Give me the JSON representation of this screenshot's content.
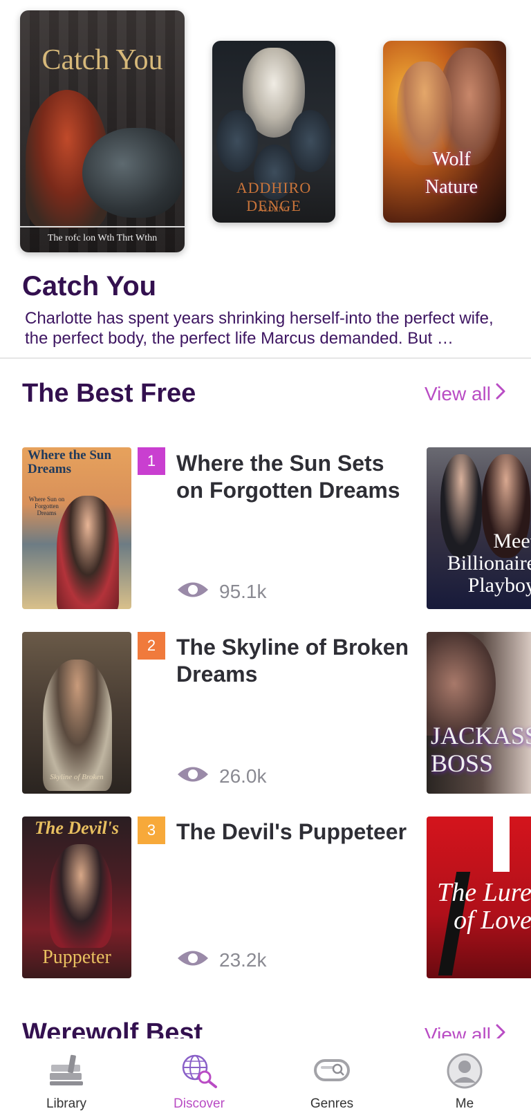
{
  "carousel": {
    "items": [
      {
        "title": "Catch You",
        "subtitle": "The rofc  lon Wth Thrt Wthn"
      },
      {
        "title": "ADDHIRO DENGE",
        "subtitle": "ALDENG"
      },
      {
        "title": "Wolf Nature"
      }
    ]
  },
  "featured": {
    "title": "Catch You",
    "description": "Charlotte has spent years shrinking herself-into the perfect wife, the perfect body, the perfect life Marcus demanded. But …"
  },
  "best_free": {
    "title": "The Best Free",
    "view_all": "View all",
    "books": [
      {
        "rank": "1",
        "rank_color": "#c93fd0",
        "title": "Where the Sun Sets on Forgotten Dreams",
        "views": "95.1k",
        "cover_text": "Where the Sun Dreams",
        "cover_sub": "Where Sun on Forgotten Dreams"
      },
      {
        "rank": "2",
        "rank_color": "#f07a3c",
        "title": "The Skyline of Broken Dreams",
        "views": "26.0k",
        "cover_text": "Skyline of Broken"
      },
      {
        "rank": "3",
        "rank_color": "#f7a93a",
        "title": "The Devil's Puppeteer",
        "views": "23.2k",
        "cover_text": "The Devil's",
        "cover_sub": "Puppeter"
      }
    ],
    "side_covers": [
      {
        "text": "Meet Billionaire Playboy"
      },
      {
        "text": "JACKASS BOSS"
      },
      {
        "text": "The Lure of Love"
      }
    ]
  },
  "werewolf": {
    "title": "Werewolf Best",
    "view_all": "View all"
  },
  "nav": {
    "items": [
      {
        "label": "Library",
        "icon": "library-icon"
      },
      {
        "label": "Discover",
        "icon": "discover-icon",
        "active": true
      },
      {
        "label": "Genres",
        "icon": "genres-icon"
      },
      {
        "label": "Me",
        "icon": "me-icon"
      }
    ]
  }
}
